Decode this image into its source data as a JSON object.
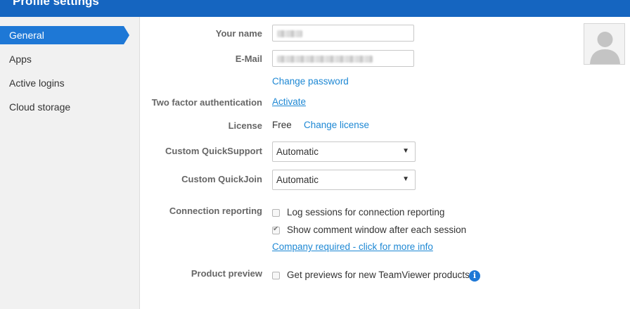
{
  "header": {
    "title": "Profile settings"
  },
  "sidebar": {
    "items": [
      {
        "label": "General",
        "active": true
      },
      {
        "label": "Apps"
      },
      {
        "label": "Active logins"
      },
      {
        "label": "Cloud storage"
      }
    ]
  },
  "form": {
    "your_name": {
      "label": "Your name",
      "value": ""
    },
    "email": {
      "label": "E-Mail",
      "value": ""
    },
    "change_password": "Change password",
    "two_factor": {
      "label": "Two factor authentication",
      "link": "Activate"
    },
    "license": {
      "label": "License",
      "value": "Free",
      "link": "Change license"
    },
    "custom_quicksupport": {
      "label": "Custom QuickSupport",
      "selected": "Automatic"
    },
    "custom_quickjoin": {
      "label": "Custom QuickJoin",
      "selected": "Automatic"
    },
    "connection_reporting": {
      "label": "Connection reporting",
      "options": [
        {
          "label": "Log sessions for connection reporting",
          "checked": false
        },
        {
          "label": "Show comment window after each session",
          "checked": true
        }
      ],
      "link": "Company required - click for more info"
    },
    "product_preview": {
      "label": "Product preview",
      "option": {
        "label": "Get previews for new TeamViewer products",
        "checked": false
      },
      "info_icon": "info-icon"
    }
  },
  "colors": {
    "header": "#1565c0",
    "accent": "#1e78d6",
    "link": "#1e88d4"
  }
}
